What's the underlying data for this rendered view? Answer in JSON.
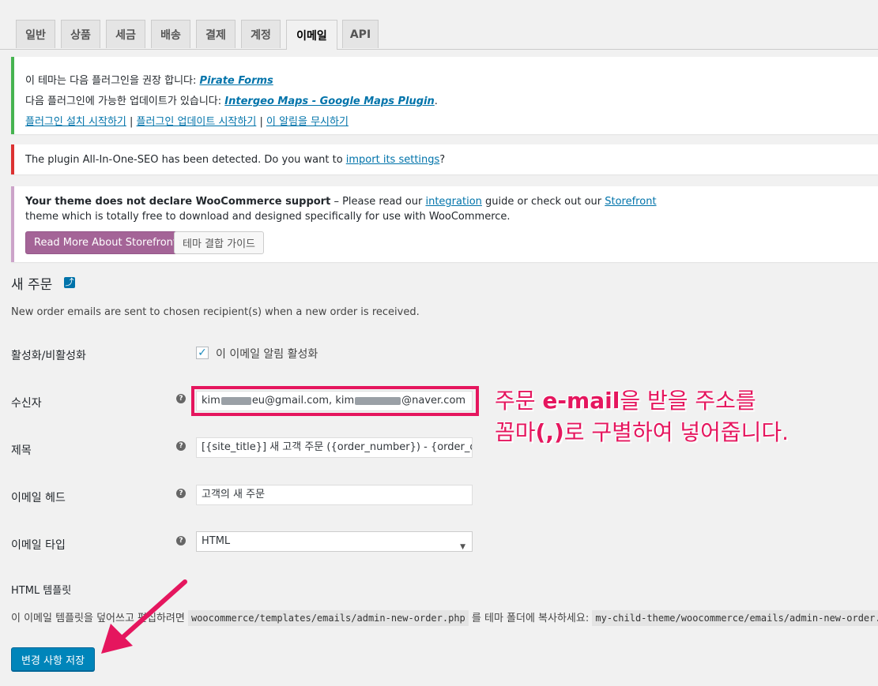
{
  "tabs": [
    {
      "label": "일반",
      "active": false
    },
    {
      "label": "상품",
      "active": false
    },
    {
      "label": "세금",
      "active": false
    },
    {
      "label": "배송",
      "active": false
    },
    {
      "label": "결제",
      "active": false
    },
    {
      "label": "계정",
      "active": false
    },
    {
      "label": "이메일",
      "active": true
    },
    {
      "label": "API",
      "active": false
    }
  ],
  "notice_plugins": {
    "line1_text": "이 테마는 다음 플러그인을 권장 합니다: ",
    "line1_link": "Pirate Forms",
    "line2_text": "다음 플러그인에 가능한 업데이트가 있습니다: ",
    "line2_link": "Intergeo Maps - Google Maps Plugin",
    "line2_suffix": ".",
    "action_install": "플러그인 설치 시작하기",
    "action_update": "플러그인 업데이트 시작하기",
    "action_dismiss": "이 알림을 무시하기",
    "separator": " | "
  },
  "notice_seo": {
    "text": "The plugin All-In-One-SEO has been detected. Do you want to ",
    "link": "import its settings",
    "suffix": "?"
  },
  "notice_theme": {
    "bold": "Your theme does not declare WooCommerce support",
    "text1": " – Please read our ",
    "link1": "integration",
    "text2": " guide or check out our ",
    "link2": "Storefront",
    "line2": "theme which is totally free to download and designed specifically for use with WooCommerce.",
    "btn_storefront": "Read More About Storefront",
    "btn_guide": "테마 결합 가이드"
  },
  "section": {
    "title": "새 주문",
    "description": "New order emails are sent to chosen recipient(s) when a new order is received."
  },
  "fields": {
    "enable_label": "활성화/비활성화",
    "enable_checkbox_label": "이 이메일 알림 활성화",
    "enable_checked": true,
    "recipient_label": "수신자",
    "recipient_part1": "kim",
    "recipient_part2": "eu@gmail.com, kim",
    "recipient_part3": "@naver.com",
    "subject_label": "제목",
    "subject_value": "[{site_title}] 새 고객 주문 ({order_number}) - {order_date}",
    "heading_label": "이메일 헤드",
    "heading_value": "고객의 새 주문",
    "type_label": "이메일 타입",
    "type_value": "HTML"
  },
  "template": {
    "title": "HTML 템플릿",
    "text1": "이 이메일 템플릿을 덮어쓰고 편집하려면 ",
    "code1": "woocommerce/templates/emails/admin-new-order.php",
    "text2": " 를 테마 폴더에 복사하세요: ",
    "code2": "my-child-theme/woocommerce/emails/admin-new-order.php"
  },
  "annotation": {
    "line1_a": "주문 ",
    "line1_b": "e-mail",
    "line1_c": "을 받을 주소를",
    "line2_a": "꼼마",
    "line2_b": "(,)",
    "line2_c": "로 구별하여 넣어줍니다."
  },
  "save_button": "변경 사항 저장",
  "colors": {
    "accent": "#0073aa",
    "annotation": "#e5165e",
    "success": "#46b450",
    "error": "#dc3232",
    "woo": "#a46497"
  }
}
